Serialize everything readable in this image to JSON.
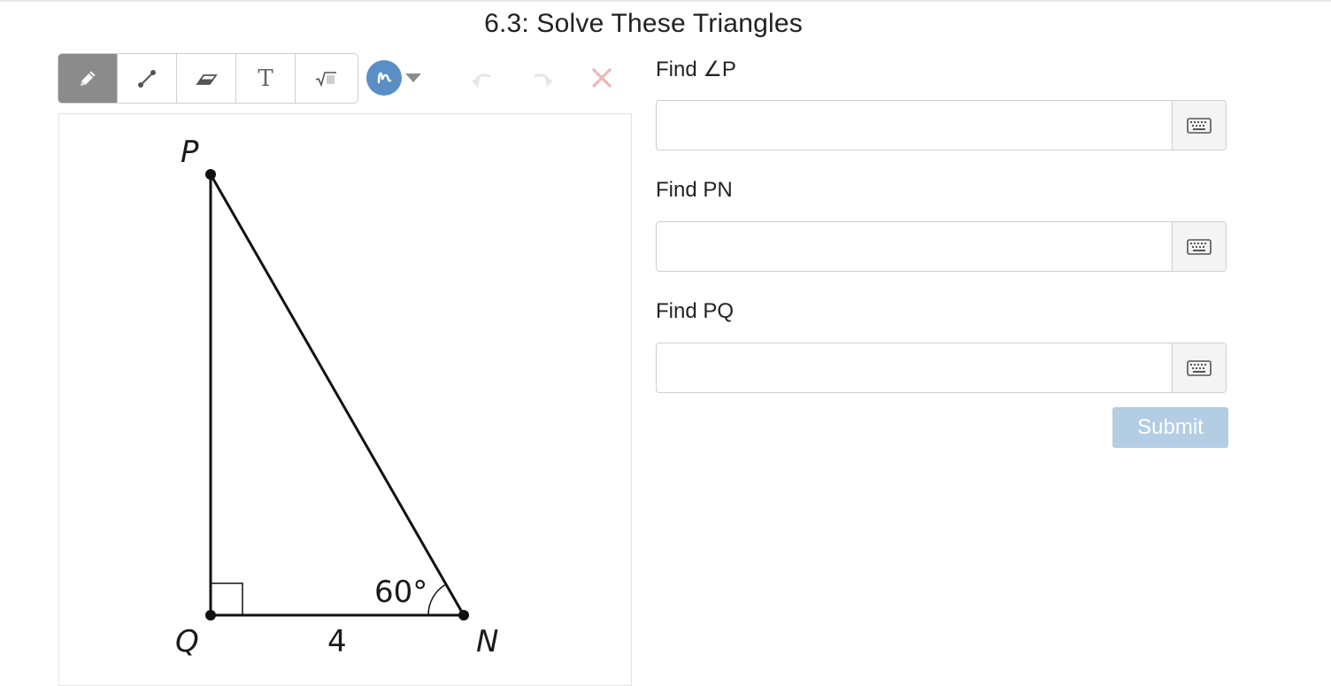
{
  "header": {
    "title": "6.3: Solve These Triangles"
  },
  "toolbar": {
    "tools": [
      {
        "name": "pencil",
        "icon": "pencil-icon",
        "active": true
      },
      {
        "name": "line",
        "icon": "line-segment-icon",
        "active": false
      },
      {
        "name": "eraser",
        "icon": "eraser-icon",
        "active": false
      },
      {
        "name": "text",
        "icon": "text-icon",
        "glyph": "T",
        "active": false
      },
      {
        "name": "math",
        "icon": "square-root-icon",
        "glyph": "√",
        "active": false
      }
    ],
    "pen_color": "#5a8fc6",
    "undo_icon": "undo-icon",
    "redo_icon": "redo-icon",
    "clear_icon": "clear-x-icon"
  },
  "figure": {
    "vertex_p": "P",
    "vertex_q": "Q",
    "vertex_n": "N",
    "side_qn": "4",
    "angle_n": "60°"
  },
  "questions": [
    {
      "label": "Find ∠P",
      "value": "",
      "keyboard_icon": "keyboard-icon"
    },
    {
      "label": "Find PN",
      "value": "",
      "keyboard_icon": "keyboard-icon"
    },
    {
      "label": "Find PQ",
      "value": "",
      "keyboard_icon": "keyboard-icon"
    }
  ],
  "submit": {
    "label": "Submit",
    "disabled": true,
    "color": "#b3cde3"
  }
}
